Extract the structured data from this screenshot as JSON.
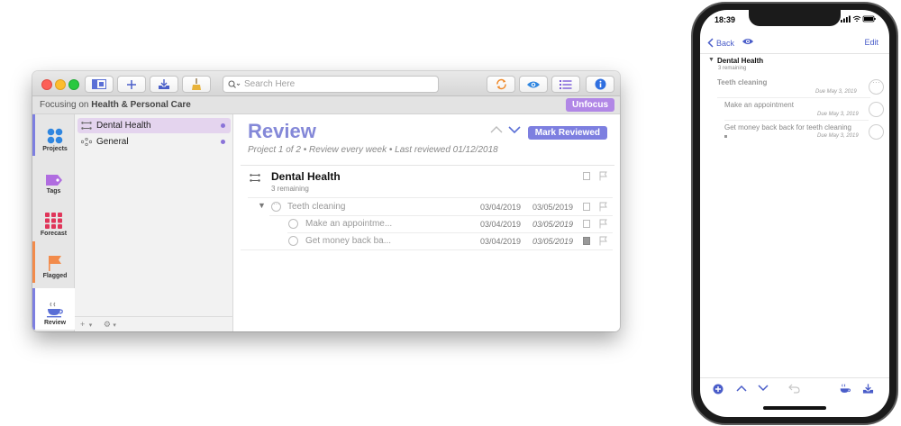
{
  "mac": {
    "toolbar": {
      "search_placeholder": "Search Here"
    },
    "focus_bar": {
      "prefix": "Focusing on",
      "folder": "Health & Personal Care",
      "unfocus_label": "Unfocus"
    },
    "rail": [
      {
        "label": "Projects"
      },
      {
        "label": "Tags"
      },
      {
        "label": "Forecast"
      },
      {
        "label": "Flagged"
      },
      {
        "label": "Review"
      }
    ],
    "projects": [
      {
        "name": "Dental Health",
        "selected": true
      },
      {
        "name": "General",
        "selected": false
      }
    ],
    "list_bottom": {
      "add": "+",
      "gear": "⚙"
    },
    "review": {
      "title": "Review",
      "subtitle": "Project 1 of 2 • Review every week • Last reviewed 01/12/2018",
      "mark_reviewed_label": "Mark Reviewed",
      "project_name": "Dental Health",
      "remaining": "3 remaining",
      "tasks": [
        {
          "name": "Teeth cleaning",
          "defer": "03/04/2019",
          "due": "03/05/2019",
          "is_parent": true
        },
        {
          "name": "Make an appointme...",
          "defer": "03/04/2019",
          "due": "03/05/2019",
          "is_parent": false
        },
        {
          "name": "Get money back ba...",
          "defer": "03/04/2019",
          "due": "03/05/2019",
          "is_parent": false
        }
      ]
    }
  },
  "phone": {
    "status_time": "18:39",
    "nav": {
      "back_label": "Back",
      "edit_label": "Edit"
    },
    "project_name": "Dental Health",
    "remaining": "3 remaining",
    "tasks": [
      {
        "name": "Teeth cleaning",
        "due": "Due May 3, 2019"
      },
      {
        "name": "Make an appointment",
        "due": "Due May 3, 2019"
      },
      {
        "name": "Get money back back for teeth cleaning",
        "due": "Due May 3, 2019"
      }
    ]
  },
  "colors": {
    "accent": "#7d7fe0",
    "review_title": "#8488d8",
    "unfocus": "#b187e6",
    "flagged": "#f28b4b",
    "projects": "#2f86e0",
    "tags": "#b06de0",
    "forecast": "#e0365a"
  }
}
